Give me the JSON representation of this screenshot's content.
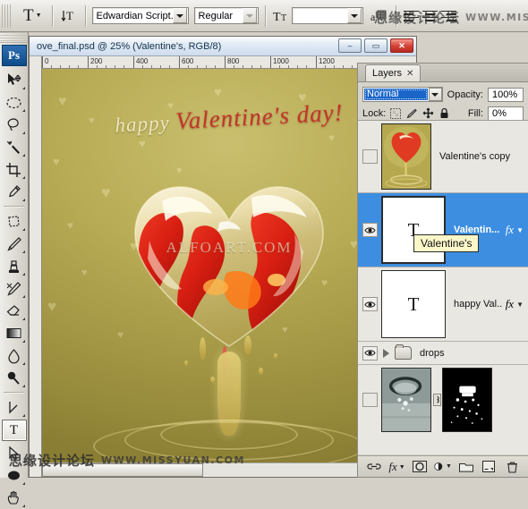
{
  "options_bar": {
    "tool_icon": "type-tool-icon",
    "orientation_icon": "text-orientation-icon",
    "font_family": "Edwardian Script...",
    "font_style": "Regular",
    "font_size_label": "font-size-icon",
    "font_size": "",
    "antialias_icon": "anti-alias-icon",
    "align_left": "align-left-icon",
    "align_center": "align-center-icon",
    "align_right": "align-right-icon"
  },
  "toolbox": {
    "logo": "Ps",
    "tools": [
      {
        "name": "move-tool",
        "selected": false
      },
      {
        "name": "elliptical-marquee-tool",
        "selected": false
      },
      {
        "name": "lasso-tool",
        "selected": false
      },
      {
        "name": "magic-wand-tool",
        "selected": false
      },
      {
        "name": "crop-tool",
        "selected": false
      },
      {
        "name": "eyedropper-tool",
        "selected": false
      },
      {
        "name": "patch-tool",
        "selected": false
      },
      {
        "name": "brush-tool",
        "selected": false
      },
      {
        "name": "clone-stamp-tool",
        "selected": false
      },
      {
        "name": "history-brush-tool",
        "selected": false
      },
      {
        "name": "eraser-tool",
        "selected": false
      },
      {
        "name": "gradient-tool",
        "selected": false
      },
      {
        "name": "blur-tool",
        "selected": false
      },
      {
        "name": "dodge-tool",
        "selected": false
      },
      {
        "name": "pen-tool",
        "selected": false
      },
      {
        "name": "type-tool",
        "selected": true
      },
      {
        "name": "path-selection-tool",
        "selected": false
      },
      {
        "name": "ellipse-shape-tool",
        "selected": false
      },
      {
        "name": "hand-tool",
        "selected": false
      }
    ]
  },
  "document": {
    "title": "ove_final.psd @ 25% (Valentine's, RGB/8)",
    "minimize_label": "–",
    "maximize_label": "▭",
    "close_label": "✕",
    "ruler_ticks": [
      "0",
      "200",
      "400",
      "600",
      "800",
      "1000",
      "1200"
    ],
    "artwork": {
      "headline_plain": "happy ",
      "headline_script": "Valentine's day!",
      "watermark": "ALFOART.COM"
    }
  },
  "layers_panel": {
    "tab_label": "Layers",
    "tab_close": "✕",
    "blend_mode": "Normal",
    "opacity_label": "Opacity:",
    "opacity_value": "100%",
    "lock_label": "Lock:",
    "lock_icons": [
      "lock-transparent-pixels-icon",
      "lock-image-pixels-icon",
      "lock-position-icon",
      "lock-all-icon"
    ],
    "fill_label": "Fill:",
    "fill_value": "0%",
    "tooltip": "Valentine's",
    "layers": [
      {
        "name": "Valentine's copy",
        "visible": false,
        "thumb": "artwork",
        "fx": false,
        "selected": false,
        "kind": "image"
      },
      {
        "name": "Valentin...",
        "visible": true,
        "thumb": "type",
        "fx": true,
        "selected": true,
        "kind": "type"
      },
      {
        "name": "happy Val...",
        "visible": true,
        "thumb": "type",
        "fx": true,
        "selected": false,
        "kind": "type"
      },
      {
        "name": "drops",
        "visible": true,
        "thumb": "folder",
        "fx": false,
        "selected": false,
        "kind": "group"
      },
      {
        "name": "",
        "visible": false,
        "thumb": "photo",
        "fx": false,
        "selected": false,
        "kind": "masked"
      }
    ],
    "footer_icons": [
      "link-layers-icon",
      "add-layer-style-icon",
      "add-layer-mask-icon",
      "new-adjustment-layer-icon",
      "new-group-icon",
      "new-layer-icon",
      "delete-layer-icon"
    ],
    "footer_fx_label": "fx"
  },
  "watermarks": {
    "top": {
      "cn": "思缘设计论坛",
      "en": "WWW.MISSYUAN.COM"
    },
    "bottom": {
      "cn": "思缘设计论坛",
      "en": "WWW.MISSYUAN.COM"
    }
  }
}
